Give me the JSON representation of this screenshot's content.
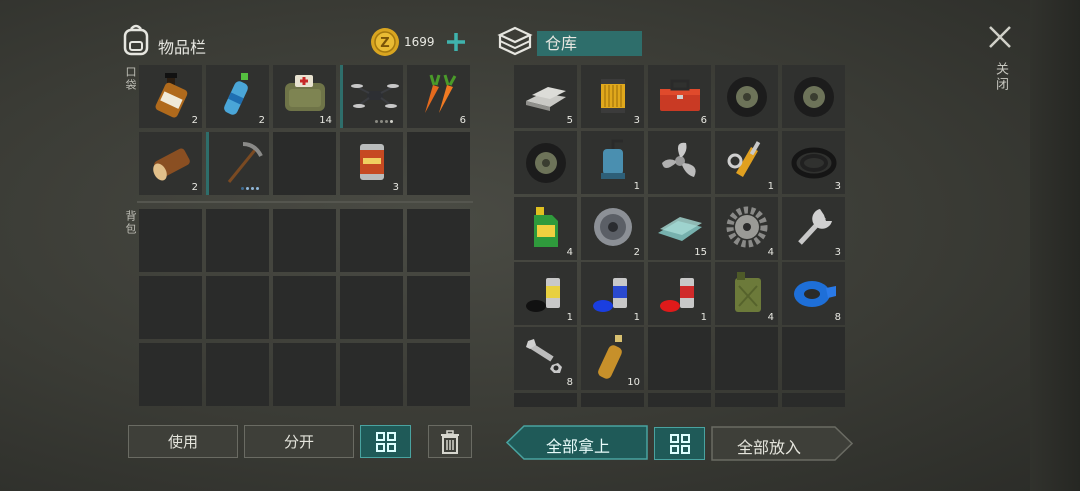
{
  "inventory": {
    "title": "物品栏",
    "coins": "1699",
    "pocket_label": "口袋",
    "backpack_label": "背包",
    "pocket_items": [
      {
        "icon": "whiskey-bottle-icon",
        "qty": "2"
      },
      {
        "icon": "water-bottle-icon",
        "qty": "2"
      },
      {
        "icon": "first-aid-bag-icon",
        "qty": "14"
      },
      {
        "icon": "drone-icon",
        "qty": ""
      },
      {
        "icon": "carrots-icon",
        "qty": "6"
      },
      {
        "icon": "wood-log-icon",
        "qty": "2"
      },
      {
        "icon": "pickaxe-icon",
        "qty": ""
      },
      {
        "icon": "",
        "qty": ""
      },
      {
        "icon": "canned-food-icon",
        "qty": "3"
      },
      {
        "icon": "",
        "qty": ""
      }
    ],
    "buttons": {
      "use": "使用",
      "split": "分开"
    }
  },
  "storage": {
    "title": "仓库",
    "items": [
      {
        "icon": "metal-ingots-icon",
        "qty": "5"
      },
      {
        "icon": "oil-filter-icon",
        "qty": "3"
      },
      {
        "icon": "toolbox-icon",
        "qty": "6"
      },
      {
        "icon": "tire-icon",
        "qty": ""
      },
      {
        "icon": "tire-icon",
        "qty": ""
      },
      {
        "icon": "tire-icon",
        "qty": ""
      },
      {
        "icon": "water-pump-icon",
        "qty": "1"
      },
      {
        "icon": "propeller-icon",
        "qty": ""
      },
      {
        "icon": "hydraulic-cylinder-icon",
        "qty": "1"
      },
      {
        "icon": "hose-icon",
        "qty": "3"
      },
      {
        "icon": "motor-oil-icon",
        "qty": "4"
      },
      {
        "icon": "pulley-icon",
        "qty": "2"
      },
      {
        "icon": "glass-sheets-icon",
        "qty": "15"
      },
      {
        "icon": "gear-icon",
        "qty": "4"
      },
      {
        "icon": "wrench-icon",
        "qty": "3"
      },
      {
        "icon": "spray-paint-black-icon",
        "qty": "1"
      },
      {
        "icon": "spray-paint-blue-icon",
        "qty": "1"
      },
      {
        "icon": "spray-paint-red-icon",
        "qty": "1"
      },
      {
        "icon": "jerrycan-icon",
        "qty": "4"
      },
      {
        "icon": "duct-tape-icon",
        "qty": "8"
      },
      {
        "icon": "bolts-nuts-icon",
        "qty": "8"
      },
      {
        "icon": "plastic-bottle-icon",
        "qty": "10"
      },
      {
        "icon": "",
        "qty": ""
      },
      {
        "icon": "",
        "qty": ""
      },
      {
        "icon": "",
        "qty": ""
      }
    ],
    "buttons": {
      "take_all": "全部拿上",
      "put_all": "全部放入"
    }
  },
  "close_label": "关闭",
  "colors": {
    "accent": "#2e6e6b",
    "accent_border": "#49a3a0",
    "coin": "#d9a520",
    "plus": "#3fb3ad"
  }
}
